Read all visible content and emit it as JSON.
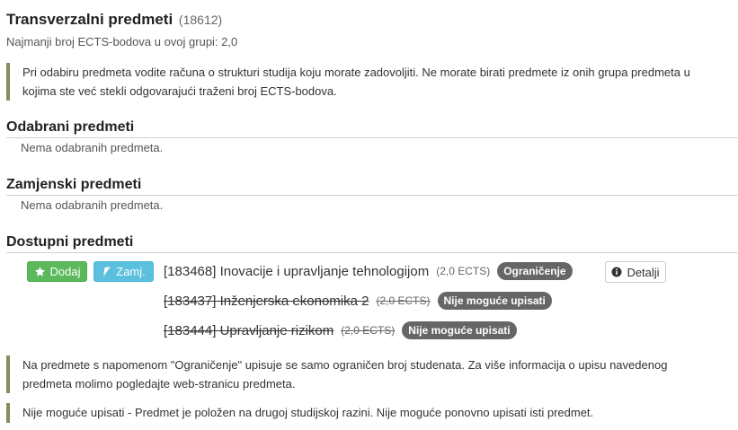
{
  "group": {
    "title": "Transverzalni predmeti",
    "id": "(18612)",
    "min_ects": "Najmanji broj ECTS-bodova u ovoj grupi: 2,0"
  },
  "notice": {
    "line1": "Pri odabiru predmeta vodite računa o strukturi studija koju morate zadovoljiti. Ne morate birati predmete iz onih grupa predmeta u",
    "line2": "kojima ste već stekli odgovarajući traženi broj ECTS-bodova."
  },
  "sections": {
    "selected": {
      "title": "Odabrani predmeti",
      "empty": "Nema odabranih predmeta."
    },
    "replacement": {
      "title": "Zamjenski predmeti",
      "empty": "Nema odabranih predmeta."
    },
    "available": {
      "title": "Dostupni predmeti"
    }
  },
  "buttons": {
    "add": "Dodaj",
    "replace": "Zamj.",
    "details": "Detalji"
  },
  "courses": [
    {
      "code": "[183468]",
      "name": "Inovacije i upravljanje tehnologijom",
      "ects": "(2,0 ECTS)",
      "badge": "Ograničenje",
      "available": true
    },
    {
      "code": "[183437]",
      "name": "Inženjerska ekonomika 2",
      "ects": "(2,0 ECTS)",
      "badge": "Nije moguće upisati",
      "available": false
    },
    {
      "code": "[183444]",
      "name": "Upravljanje rizikom",
      "ects": "(2,0 ECTS)",
      "badge": "Nije moguće upisati",
      "available": false
    }
  ],
  "footnotes": {
    "restriction_line1": "Na predmete s napomenom \"Ograničenje\" upisuje se samo ograničen broj studenata. Za više informacija o upisu navedenog",
    "restriction_line2": "predmeta molimo pogledajte web-stranicu predmeta.",
    "not_possible": "Nije moguće upisati - Predmet je položen na drugoj studijskoj razini. Nije moguće ponovno upisati isti predmet."
  },
  "colors": {
    "add_button": "#5cb85c",
    "replace_button": "#5bc0de",
    "badge": "#666666",
    "note_border": "#8a8a5c"
  },
  "icons": {
    "add": "star-icon",
    "replace": "location-arrow-icon",
    "details": "info-circle-icon"
  }
}
